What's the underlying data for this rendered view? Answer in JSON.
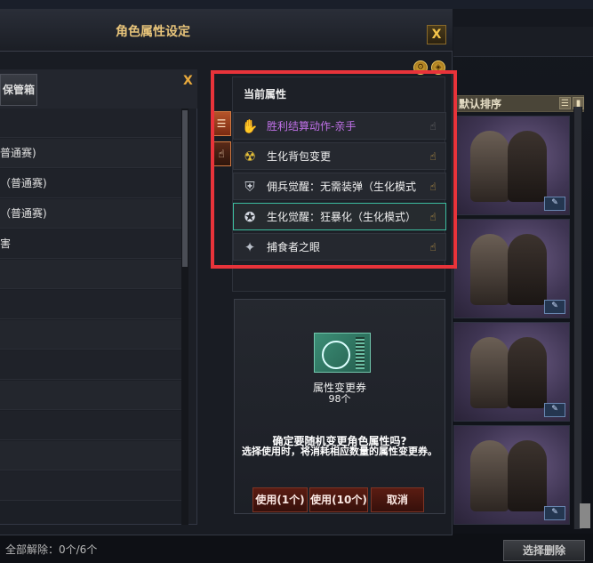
{
  "dialog": {
    "title": "角色属性设定",
    "close_label": "X"
  },
  "left_panel": {
    "box_tab_label": "保管箱",
    "close_label": "X",
    "rows": [
      {
        "label": ""
      },
      {
        "label": "普通赛)"
      },
      {
        "label": "（普通赛)"
      },
      {
        "label": "（普通赛)"
      },
      {
        "label": "害"
      },
      {
        "label": ""
      },
      {
        "label": ""
      },
      {
        "label": ""
      },
      {
        "label": ""
      },
      {
        "label": ""
      },
      {
        "label": ""
      },
      {
        "label": ""
      },
      {
        "label": ""
      }
    ]
  },
  "side_buttons": [
    {
      "icon": "list-icon",
      "glyph": "☰"
    },
    {
      "icon": "hand-icon",
      "glyph": "☝"
    }
  ],
  "current_attributes": {
    "title": "当前属性",
    "items": [
      {
        "label": "胜利结算动作-亲手",
        "icon": "victory-pose-icon",
        "glyph": "✋",
        "color": "#c071e8",
        "selected": false,
        "pin_active": false
      },
      {
        "label": "生化背包变更",
        "icon": "biohazard-backpack-icon",
        "glyph": "☢",
        "color": "#f0f0f0",
        "selected": false,
        "pin_active": true
      },
      {
        "label": "佣兵觉醒：无需装弹（生化模式",
        "icon": "mercenary-shield-icon",
        "glyph": "⛨",
        "color": "#f0f0f0",
        "selected": false,
        "pin_active": true
      },
      {
        "label": "生化觉醒：狂暴化（生化模式）",
        "icon": "berserk-icon",
        "glyph": "✪",
        "color": "#f0f0f0",
        "selected": true,
        "pin_active": true
      },
      {
        "label": "捕食者之眼",
        "icon": "predator-eye-icon",
        "glyph": "✦",
        "color": "#f0f0f0",
        "selected": false,
        "pin_active": true
      }
    ]
  },
  "ticket": {
    "name": "属性变更券",
    "count": "98个",
    "confirm_question": "确定要随机变更角色属性吗?",
    "confirm_note": "选择使用时，将消耗相应数量的属性变更券。"
  },
  "actions": {
    "use_one": "使用(1个)",
    "use_ten": "使用(10个)",
    "cancel": "取消"
  },
  "background": {
    "sort_label": "默认排序",
    "release_all": "全部解除：0个/6个",
    "select_delete": "选择删除",
    "card_button_glyph": "✎"
  },
  "colors": {
    "accent_gold": "#e8c47a",
    "highlight_red": "#e8333a",
    "selected_teal": "#3cbda0",
    "purple_text": "#c071e8"
  }
}
